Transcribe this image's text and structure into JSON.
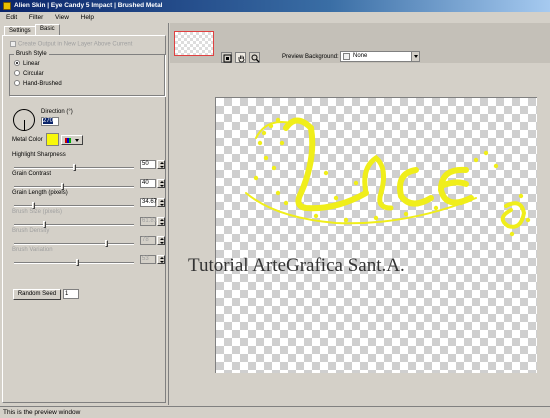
{
  "window": {
    "title": "Alien Skin | Eye Candy 5 Impact | Brushed Metal"
  },
  "menu": {
    "items": [
      "Edit",
      "Filter",
      "View",
      "Help"
    ]
  },
  "tabs": [
    {
      "label": "Settings"
    },
    {
      "label": "Basic"
    }
  ],
  "basic": {
    "create_output_label": "Create Output in New Layer Above Current",
    "brush_style": {
      "title": "Brush Style",
      "options": [
        "Linear",
        "Circular",
        "Hand-Brushed"
      ],
      "selected": "Linear"
    },
    "direction": {
      "label": "Direction (°)",
      "value": "270"
    },
    "metal_color": {
      "label": "Metal Color",
      "color": "#f8f80a"
    },
    "params": [
      {
        "label": "Highlight Sharpness",
        "value": "50",
        "fraction": 0.5,
        "enabled": true
      },
      {
        "label": "Grain Contrast",
        "value": "40",
        "fraction": 0.4,
        "enabled": true
      },
      {
        "label": "Grain Length (pixels)",
        "value": "34.67",
        "fraction": 0.15,
        "enabled": true
      },
      {
        "label": "Brush Size (pixels)",
        "value": "61.81",
        "fraction": 0.25,
        "enabled": false
      },
      {
        "label": "Brush Density",
        "value": "78",
        "fraction": 0.78,
        "enabled": false
      },
      {
        "label": "Brush Variation",
        "value": "53",
        "fraction": 0.53,
        "enabled": false
      }
    ],
    "random_seed": {
      "button_label": "Random Seed",
      "value": "1"
    }
  },
  "preview": {
    "background_label": "Preview Background:",
    "background_value": "None",
    "canvas_text": "Tutorial ArteGrafica Sant.A.",
    "accent_color": "#f0ee1a",
    "tools": [
      "zoom-fit-icon",
      "hand-icon",
      "magnifier-icon"
    ]
  },
  "status": {
    "text": "This is the preview window"
  }
}
